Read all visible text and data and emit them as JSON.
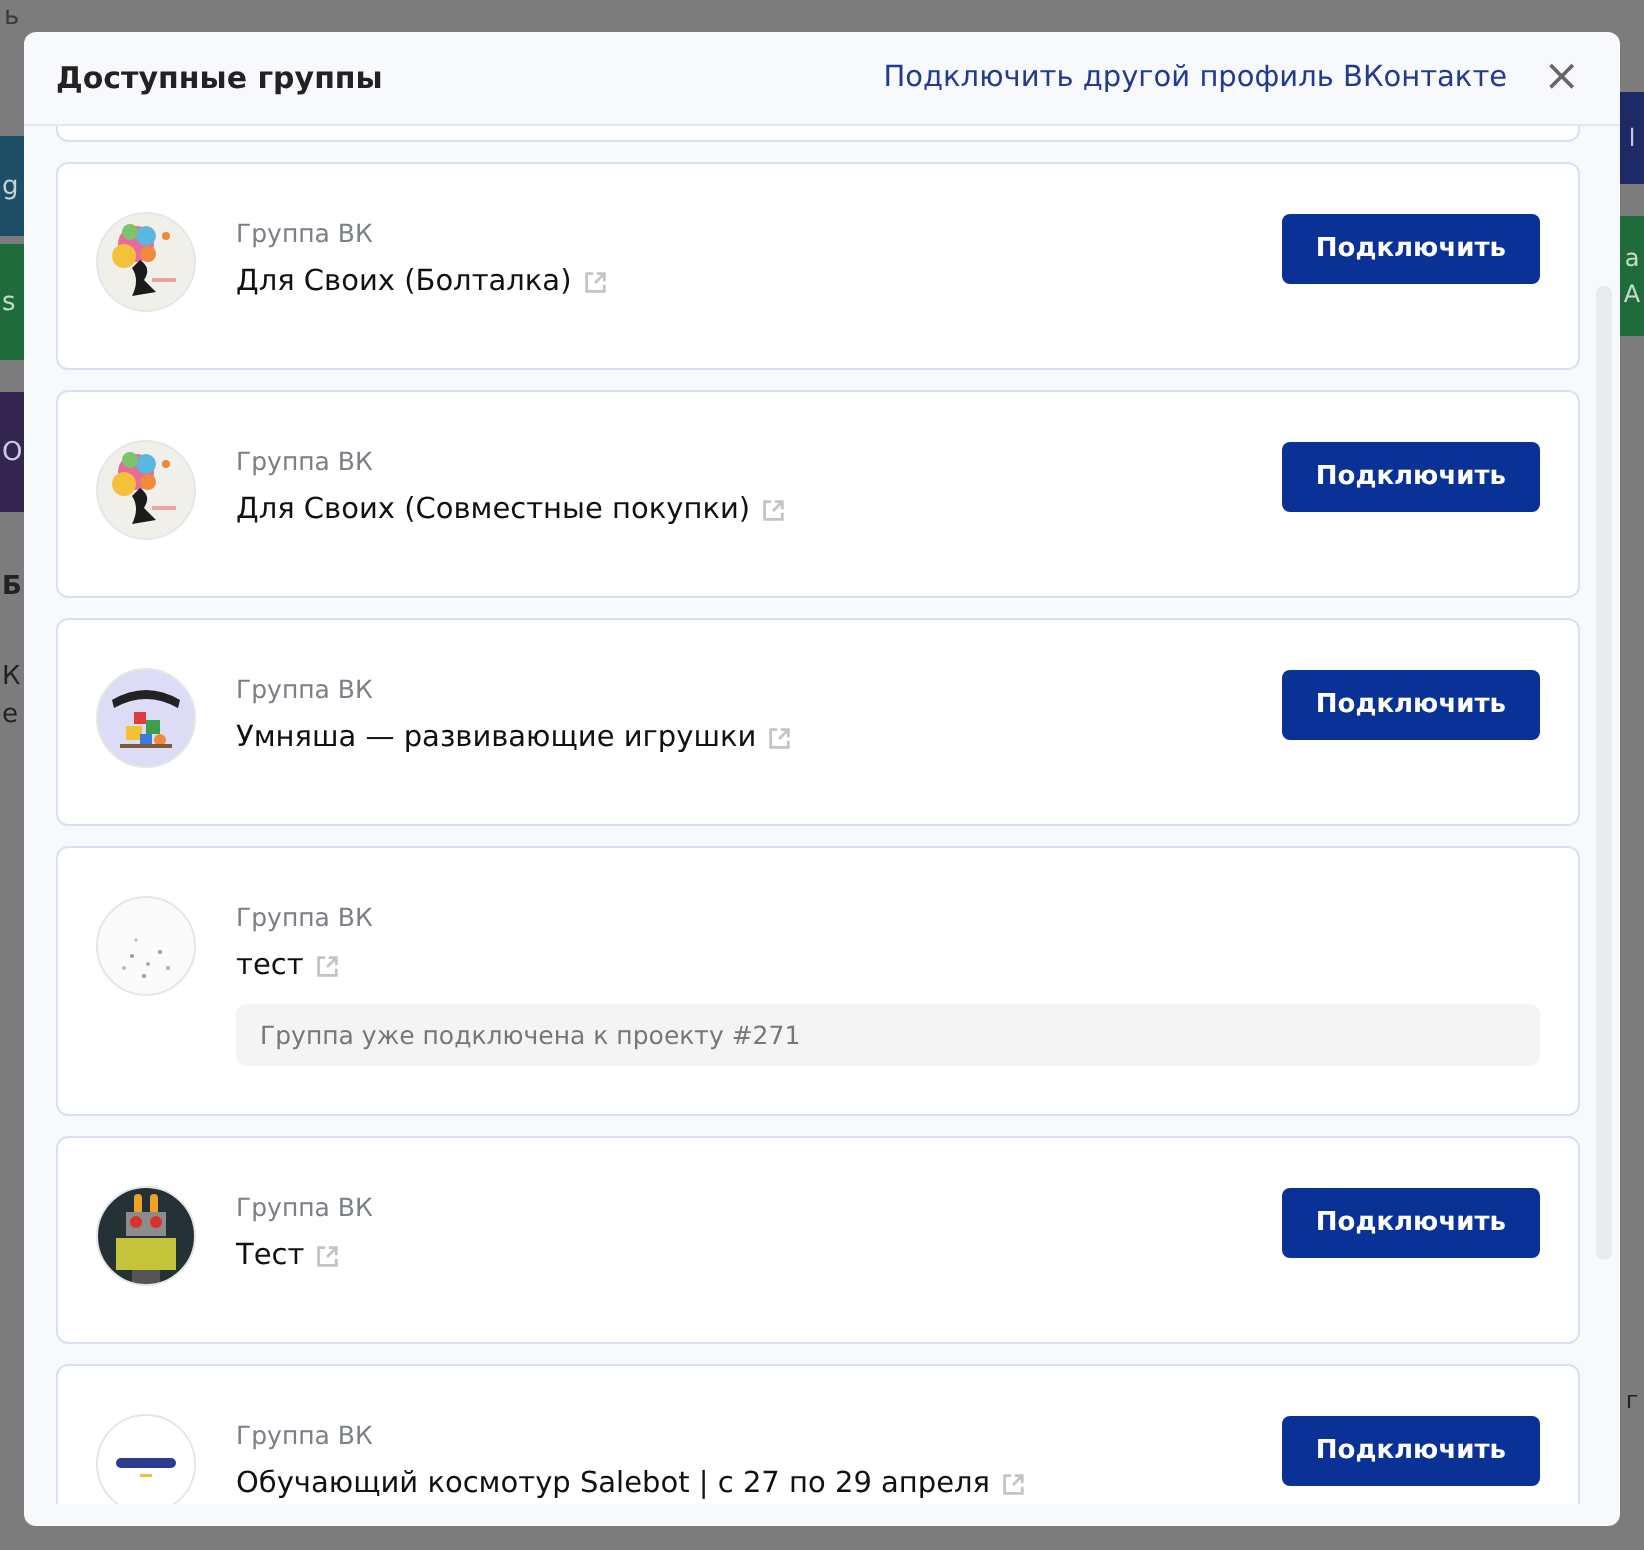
{
  "background": {
    "left": [
      "ь",
      "g",
      "s",
      "О",
      "Б",
      "К",
      "е"
    ],
    "right": [
      "l",
      "а",
      "А",
      "г"
    ]
  },
  "dialog": {
    "title": "Доступные группы",
    "link": "Подключить другой профиль ВКонтакте",
    "close": "×"
  },
  "groups": [
    {
      "kind": "available",
      "label": "Группа ВК",
      "name": "Для Своих (Болталка)",
      "button": "Подключить"
    },
    {
      "kind": "available",
      "label": "Группа ВК",
      "name": "Для Своих (Совместные покупки)",
      "button": "Подключить"
    },
    {
      "kind": "available",
      "label": "Группа ВК",
      "name": "Умняша — развивающие игрушки",
      "button": "Подключить"
    },
    {
      "kind": "connected",
      "label": "Группа ВК",
      "name": "тест",
      "notice": "Группа уже подключена к проекту #271"
    },
    {
      "kind": "available",
      "label": "Группа ВК",
      "name": "Тест",
      "button": "Подключить"
    },
    {
      "kind": "available",
      "label": "Группа ВК",
      "name": "Обучающий космотур Salebot | с 27 по 29 апреля",
      "button": "Подключить"
    }
  ]
}
